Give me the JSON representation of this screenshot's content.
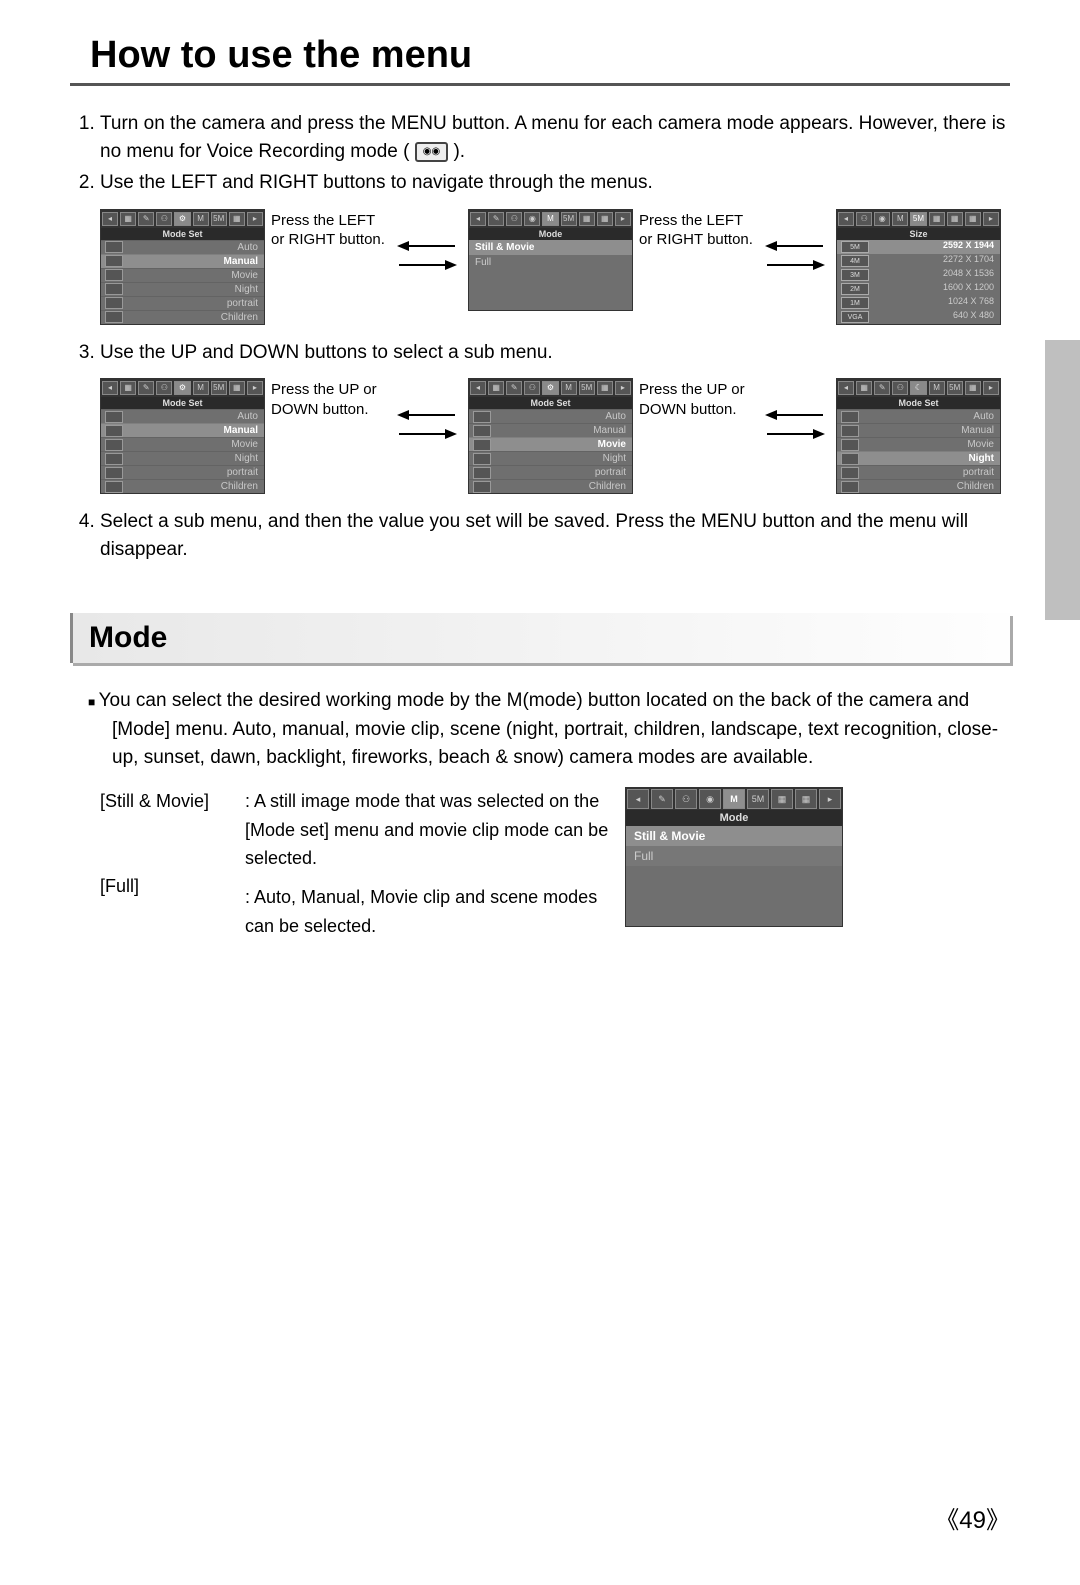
{
  "title": "How to use the menu",
  "steps": {
    "s1": "Turn on the camera and press the MENU button. A menu for each camera mode appears. However, there is no menu for Voice Recording mode (",
    "s1_tail": ").",
    "s2": "Use the LEFT and RIGHT buttons to navigate through the menus.",
    "s3": "Use the UP and DOWN buttons to select a sub menu.",
    "s4": "Select a sub menu, and then the value you set will be saved. Press the MENU button and the menu will disappear."
  },
  "label_lr": "Press the LEFT or RIGHT button.",
  "label_ud": "Press the UP or DOWN button.",
  "modeset_label": "Mode Set",
  "mode_label": "Mode",
  "size_label": "Size",
  "modeset_items": [
    "Auto",
    "Manual",
    "Movie",
    "Night",
    "portrait",
    "Children"
  ],
  "size_rows": [
    {
      "badge": "5M",
      "val": "2592 X 1944"
    },
    {
      "badge": "4M",
      "val": "2272 X 1704"
    },
    {
      "badge": "3M",
      "val": "2048 X 1536"
    },
    {
      "badge": "2M",
      "val": "1600 X 1200"
    },
    {
      "badge": "1M",
      "val": "1024 X 768"
    },
    {
      "badge": "VGA",
      "val": "640 X 480"
    }
  ],
  "mode_items": [
    "Still & Movie",
    "Full"
  ],
  "section2_title": "Mode",
  "mode_intro": "You can select the desired working mode by the M(mode) button located on the back of the camera and [Mode] menu. Auto, manual, movie clip, scene (night, portrait, children, landscape, text recognition, close-up, sunset, dawn, backlight, fireworks, beach & snow) camera modes are available.",
  "defs": {
    "k1": "[Still & Movie]",
    "v1": ": A still image mode that was selected on the [Mode set] menu and movie clip mode can be selected.",
    "k2": "[Full]",
    "v2": ": Auto, Manual, Movie clip and scene modes can be selected."
  },
  "big_mode_items": [
    "Still & Movie",
    "Full"
  ],
  "pagenum": "《49》"
}
